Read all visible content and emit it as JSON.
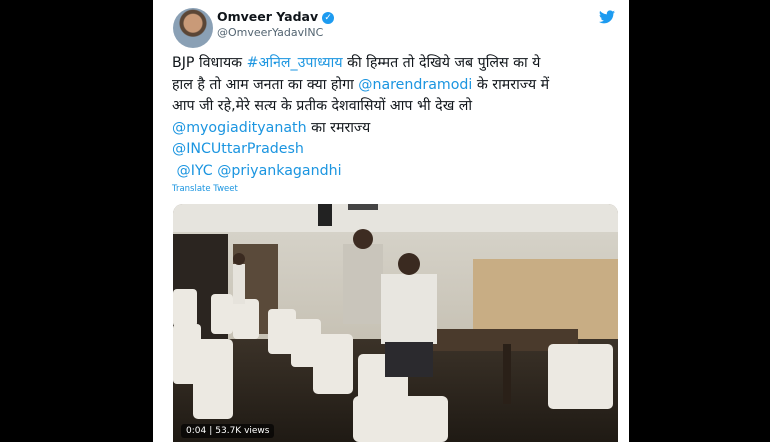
{
  "tweet": {
    "author_name": "Omveer Yadav",
    "author_handle": "@OmveerYadavINC",
    "line1_prefix": "BJP विधायक ",
    "hashtag": "#अनिल_उपाध्याय",
    "line1_suffix": " की हिम्मत तो देखिये जब पुलिस का ये",
    "line2": "हाल है तो आम जनता का क्या होगा ",
    "mention_modi": "@narendramodi",
    "line2_suffix": " के रामराज्य में",
    "line3": "आप जी रहे,मेरे सत्य के प्रतीक देशवासियों आप भी देख लो",
    "mention_yogi": "@myogiadityanath",
    "line4_suffix": " का रमराज्य",
    "mention_inc_up": "@INCUttarPradesh",
    "mention_iyc": "@IYC",
    "mention_priyanka": "@priyankagandhi",
    "translate_label": "Translate Tweet"
  },
  "video": {
    "time": "0:04",
    "views": "53.7K views"
  },
  "icons": [
    "verified-badge-icon",
    "twitter-logo-icon"
  ],
  "colors": {
    "link": "#1b95e0",
    "verified": "#1d9bf0",
    "text": "#0f1419",
    "muted": "#536471"
  }
}
